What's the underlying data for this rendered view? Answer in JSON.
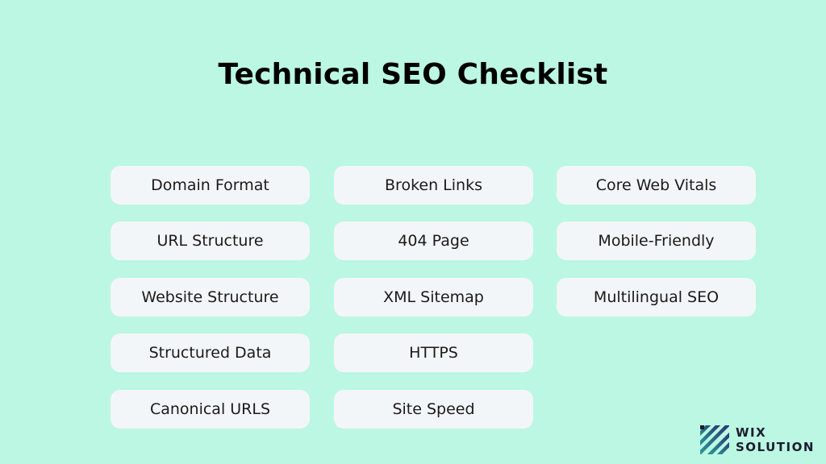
{
  "title": "Technical SEO Checklist",
  "columns": [
    {
      "items": [
        "Domain Format",
        "URL Structure",
        "Website Structure",
        "Structured Data",
        "Canonical URLS"
      ]
    },
    {
      "items": [
        "Broken Links",
        "404 Page",
        "XML Sitemap",
        "HTTPS",
        "Site Speed"
      ]
    },
    {
      "items": [
        "Core Web Vitals",
        "Mobile-Friendly",
        "Multilingual SEO"
      ]
    }
  ],
  "logo": {
    "line1": "WIX",
    "line2": "SOLUTION",
    "icon": "striped-square-logo-icon"
  },
  "colors": {
    "background": "#bbf7e3",
    "card": "#f3f6f8",
    "text": "#1a1a1a",
    "logo_teal": "#2a9d8f",
    "logo_navy": "#2b2d6e"
  }
}
